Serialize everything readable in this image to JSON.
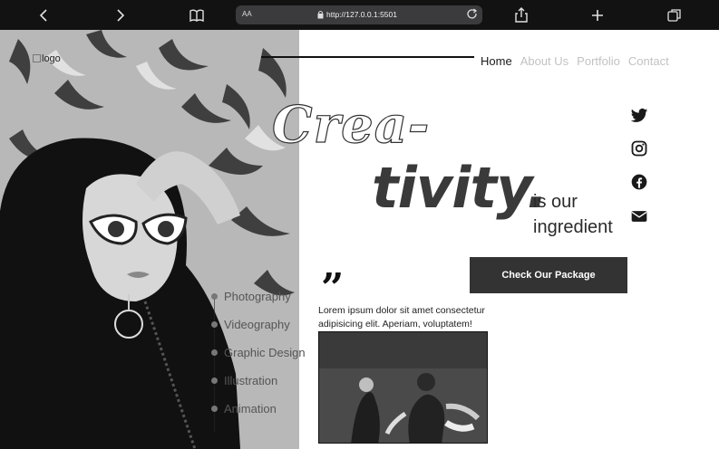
{
  "browser": {
    "text_size_label": "AA",
    "url": "http://127.0.0.1:5501"
  },
  "header": {
    "logo_alt": "logo",
    "nav": [
      {
        "label": "Home",
        "active": true
      },
      {
        "label": "About Us",
        "active": false
      },
      {
        "label": "Portfolio",
        "active": false
      },
      {
        "label": "Contact",
        "active": false
      }
    ]
  },
  "hero": {
    "title_line1": "Crea-",
    "title_line2": "tivity.",
    "tagline": "is our ingredient",
    "cta_label": "Check Our Package"
  },
  "social": [
    "twitter-icon",
    "instagram-icon",
    "facebook-icon",
    "envelope-icon"
  ],
  "services": [
    "Photography",
    "Videography",
    "Graphic Design",
    "Illustration",
    "Animation"
  ],
  "testimonial": {
    "quote_mark": "”",
    "text": "Lorem ipsum dolor sit amet consectetur adipisicing elit. Aperiam, voluptatem!"
  },
  "colors": {
    "browser_chrome": "#121212",
    "nav_active": "#1a1a1a",
    "nav_inactive": "#c2c2c2",
    "cta_bg": "#333333"
  }
}
